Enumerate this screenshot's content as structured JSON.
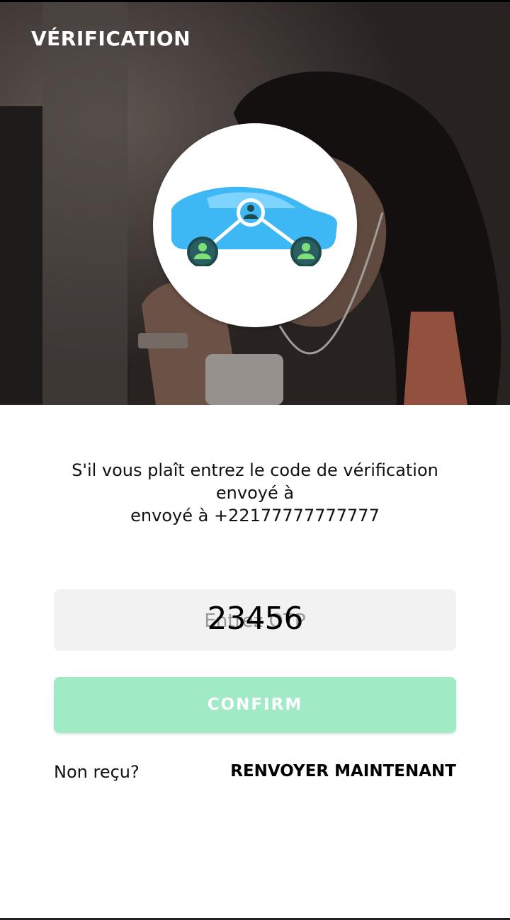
{
  "header": {
    "title": "VÉRIFICATION"
  },
  "logo": {
    "icon": "car-rideshare-logo-icon",
    "colors": {
      "car_body": "#3db8f5",
      "car_window": "#7fd4ff",
      "node_dark": "#1f4a4c",
      "node_person": "#7ee07a"
    }
  },
  "message": {
    "line1": "S'il vous plaît entrez le code de vérification",
    "line2": "envoyé à",
    "line3": "envoyé à +22177777777777"
  },
  "otp": {
    "placeholder": "Entrez OTP",
    "value": "23456"
  },
  "confirm": {
    "label": "CONFIRM",
    "color": "#a1eac6"
  },
  "resend": {
    "question": "Non reçu?",
    "link_label": "RENVOYER MAINTENANT"
  }
}
